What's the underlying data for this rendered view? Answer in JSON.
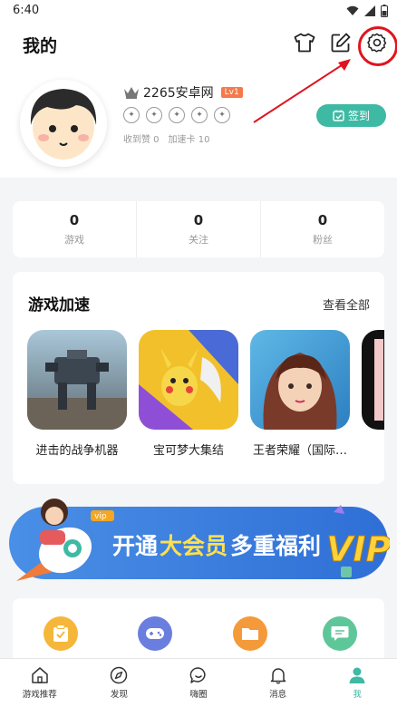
{
  "status_bar": {
    "time": "6:40"
  },
  "header": {
    "title": "我的"
  },
  "profile": {
    "username": "2265安卓网",
    "level": "Lv1",
    "likes_label": "收到赞 0",
    "boost_label": "加速卡 10",
    "signin_label": "签到"
  },
  "stats": [
    {
      "value": "0",
      "label": "游戏"
    },
    {
      "value": "0",
      "label": "关注"
    },
    {
      "value": "0",
      "label": "粉丝"
    }
  ],
  "games_section": {
    "title": "游戏加速",
    "view_all": "查看全部",
    "games": [
      {
        "name": "进击的战争机器"
      },
      {
        "name": "宝可梦大集结"
      },
      {
        "name": "王者荣耀（国际…"
      },
      {
        "name": ""
      }
    ]
  },
  "vip_banner": {
    "tag": "vip",
    "text_prefix": "开通",
    "text_highlight": "大会员",
    "text_suffix": "多重福利",
    "vip_logo": "VIP"
  },
  "tools": [
    {
      "icon": "clipboard-icon",
      "color": "#f5b73b"
    },
    {
      "icon": "gamepad-icon",
      "color": "#6a7ee0"
    },
    {
      "icon": "folder-icon",
      "color": "#f49a3a"
    },
    {
      "icon": "chat-icon",
      "color": "#5ec79a"
    }
  ],
  "tabs": [
    {
      "label": "游戏推荐",
      "icon": "home-icon",
      "active": false
    },
    {
      "label": "发现",
      "icon": "compass-icon",
      "active": false
    },
    {
      "label": "嗨圈",
      "icon": "chat-bubble-icon",
      "active": false
    },
    {
      "label": "消息",
      "icon": "bell-icon",
      "active": false
    },
    {
      "label": "我",
      "icon": "person-icon",
      "active": true
    }
  ],
  "colors": {
    "accent": "#3eb9a4",
    "annotation": "#e0141e",
    "level_badge": "#f47a4c"
  }
}
